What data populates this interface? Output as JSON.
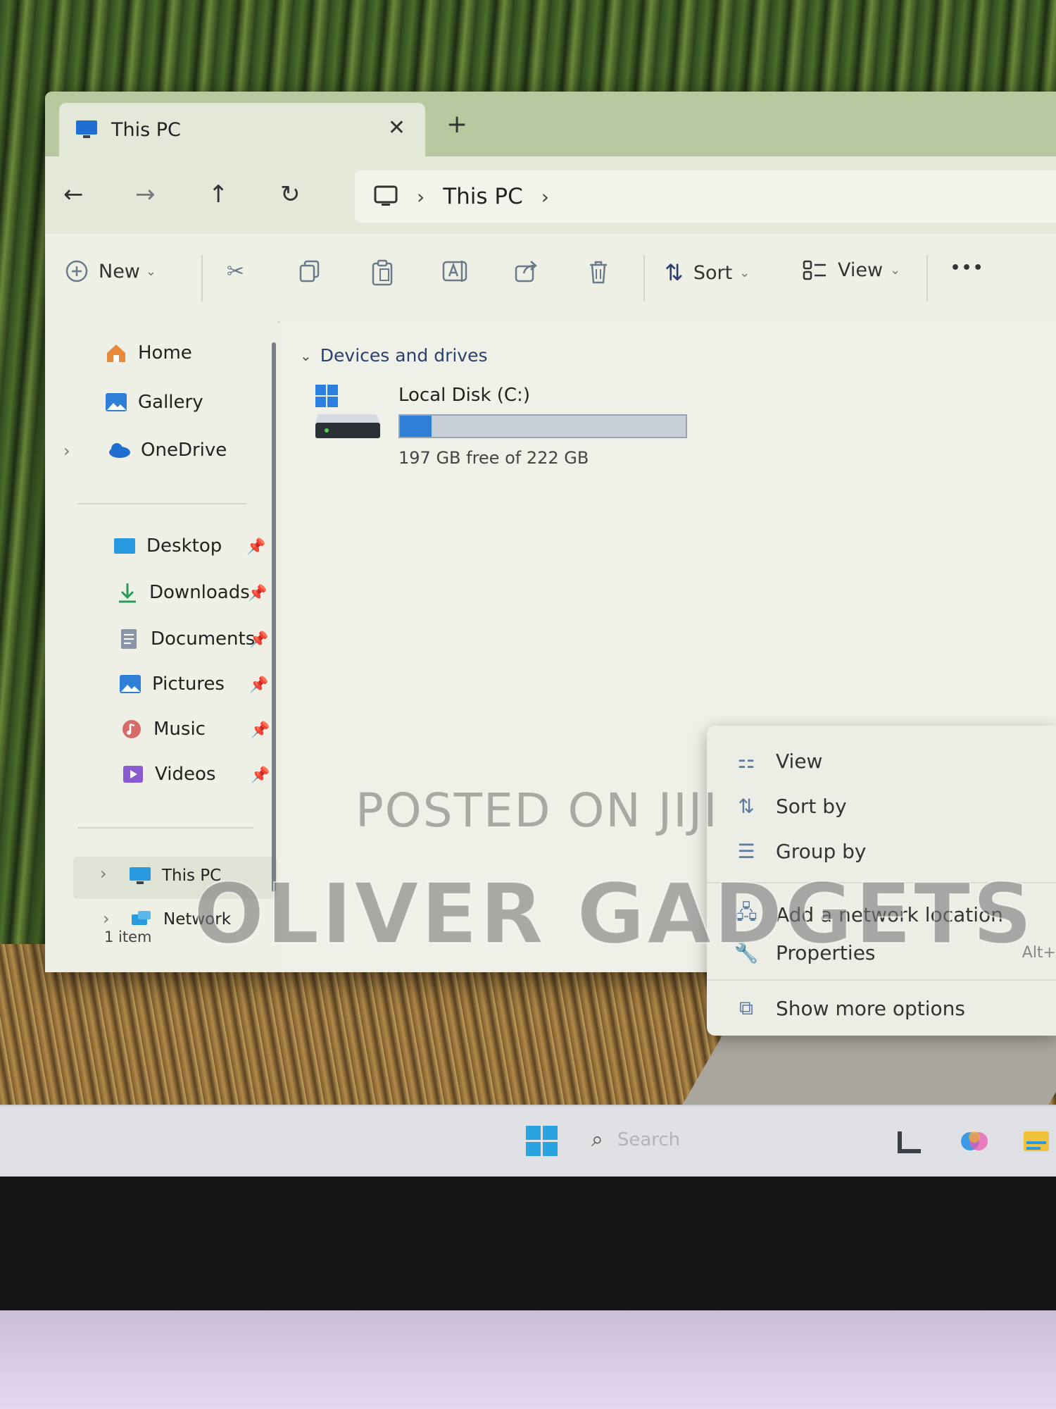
{
  "window": {
    "tab_title": "This PC",
    "close_glyph": "✕",
    "newtab_glyph": "+"
  },
  "nav": {
    "back": "←",
    "forward": "→",
    "up": "↑",
    "refresh": "↻",
    "address": [
      "This PC"
    ],
    "separator": "›"
  },
  "toolbar": {
    "new_label": "New",
    "sort_label": "Sort",
    "view_label": "View",
    "more_glyph": "•••",
    "icons": [
      "cut-icon",
      "copy-icon",
      "paste-icon",
      "rename-icon",
      "share-icon",
      "delete-icon"
    ]
  },
  "sidebar": {
    "top": [
      {
        "label": "Home",
        "icon": "home-icon"
      },
      {
        "label": "Gallery",
        "icon": "gallery-icon"
      },
      {
        "label": "OneDrive",
        "icon": "onedrive-icon"
      }
    ],
    "pinned": [
      {
        "label": "Desktop",
        "icon": "desktop-icon"
      },
      {
        "label": "Downloads",
        "icon": "downloads-icon"
      },
      {
        "label": "Documents",
        "icon": "documents-icon"
      },
      {
        "label": "Pictures",
        "icon": "pictures-icon"
      },
      {
        "label": "Music",
        "icon": "music-icon"
      },
      {
        "label": "Videos",
        "icon": "videos-icon"
      }
    ],
    "bottom": [
      {
        "label": "This PC",
        "icon": "this-pc-icon"
      },
      {
        "label": "Network",
        "icon": "network-icon"
      }
    ]
  },
  "content": {
    "group_label": "Devices and drives",
    "drive": {
      "name": "Local Disk (C:)",
      "free_text": "197 GB free of 222 GB",
      "used_fraction": 0.11
    }
  },
  "status": {
    "item_count": "1 item"
  },
  "context_menu": {
    "items": [
      {
        "label": "View",
        "icon": "view-icon"
      },
      {
        "label": "Sort by",
        "icon": "sort-icon"
      },
      {
        "label": "Group by",
        "icon": "group-icon"
      },
      {
        "label": "Add a network location",
        "icon": "network-location-icon"
      },
      {
        "label": "Properties",
        "icon": "properties-icon",
        "shortcut": "Alt+"
      },
      {
        "label": "Show more options",
        "icon": "more-options-icon"
      }
    ]
  },
  "watermark": {
    "line1": "POSTED ON JIJI",
    "line2": "OLIVER GADGETS"
  },
  "taskbar": {
    "search_placeholder": "Search"
  },
  "colors": {
    "accent": "#2f7fd6",
    "folder_link": "#2b3f6e"
  }
}
